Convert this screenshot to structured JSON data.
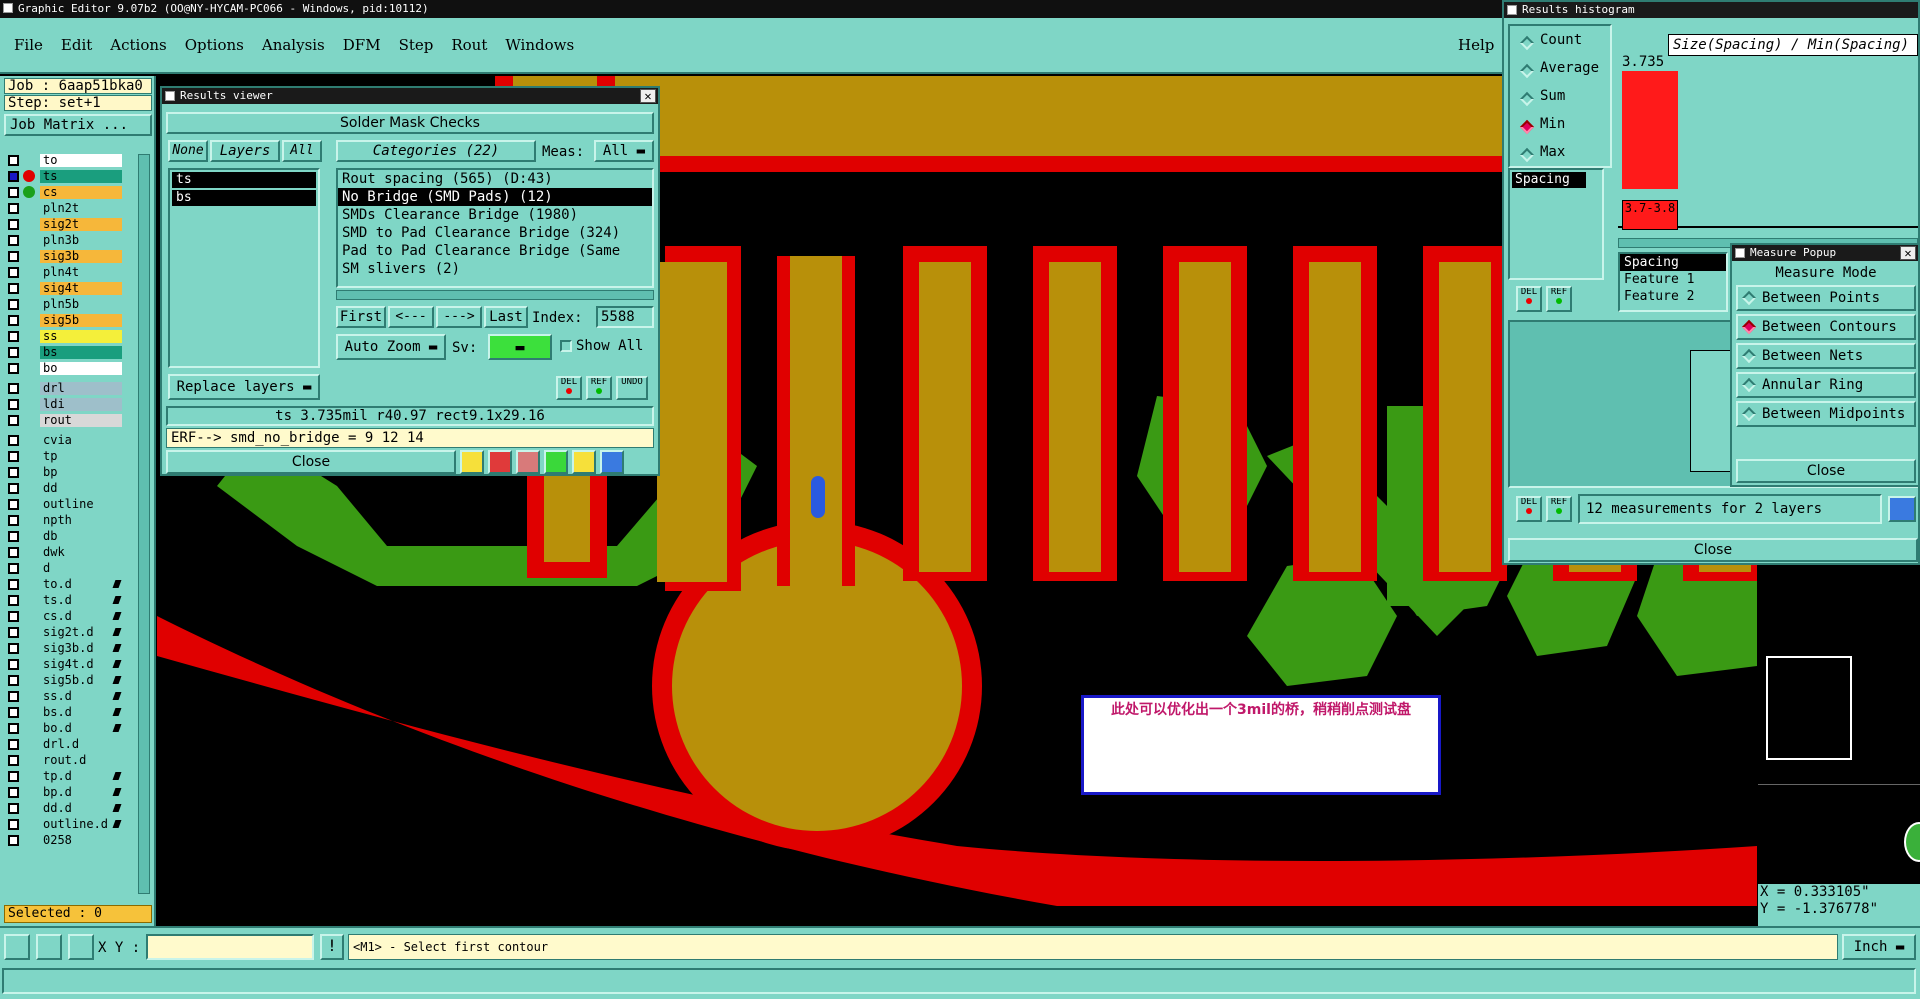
{
  "app": {
    "title": "Graphic Editor 9.07b2 (OO@NY-HYCAM-PC066 - Windows, pid:10112)",
    "menu": [
      "File",
      "Edit",
      "Actions",
      "Options",
      "Analysis",
      "DFM",
      "Step",
      "Rout",
      "Windows"
    ],
    "help": "Help"
  },
  "job": {
    "job_label": "Job : 6aap51bka0",
    "step_label": "Step: set+1",
    "matrix_button": "Job Matrix ..."
  },
  "layers": [
    {
      "name": "to",
      "bg": "#ffffff",
      "dot": ""
    },
    {
      "name": "ts",
      "bg": "#1a9e7e",
      "dot": "#e00000",
      "sel": true
    },
    {
      "name": "cs",
      "bg": "#f6b73a",
      "dot": "#1aa01a"
    },
    {
      "name": "pln2t",
      "bg": "#7fd6c6",
      "dot": ""
    },
    {
      "name": "sig2t",
      "bg": "#f6b73a",
      "dot": ""
    },
    {
      "name": "pln3b",
      "bg": "#7fd6c6",
      "dot": ""
    },
    {
      "name": "sig3b",
      "bg": "#f6b73a",
      "dot": ""
    },
    {
      "name": "pln4t",
      "bg": "#7fd6c6",
      "dot": ""
    },
    {
      "name": "sig4t",
      "bg": "#f6b73a",
      "dot": ""
    },
    {
      "name": "pln5b",
      "bg": "#7fd6c6",
      "dot": ""
    },
    {
      "name": "sig5b",
      "bg": "#f6b73a",
      "dot": ""
    },
    {
      "name": "ss",
      "bg": "#f4ef3a",
      "dot": ""
    },
    {
      "name": "bs",
      "bg": "#1a9e7e",
      "dot": ""
    },
    {
      "name": "bo",
      "bg": "#ffffff",
      "dot": ""
    },
    {
      "name": "drl",
      "bg": "#9ebfca",
      "dot": ""
    },
    {
      "name": "ldi",
      "bg": "#9ebfca",
      "dot": ""
    },
    {
      "name": "rout",
      "bg": "#d8d8d8",
      "dot": ""
    },
    {
      "name": "cvia",
      "bg": "#7fd6c6",
      "dot": ""
    },
    {
      "name": "tp",
      "bg": "#7fd6c6",
      "dot": ""
    },
    {
      "name": "bp",
      "bg": "#7fd6c6",
      "dot": ""
    },
    {
      "name": "dd",
      "bg": "#7fd6c6",
      "dot": ""
    },
    {
      "name": "outline",
      "bg": "#7fd6c6",
      "dot": ""
    },
    {
      "name": "npth",
      "bg": "#7fd6c6",
      "dot": ""
    },
    {
      "name": "db",
      "bg": "#7fd6c6",
      "dot": ""
    },
    {
      "name": "dwk",
      "bg": "#7fd6c6",
      "dot": ""
    },
    {
      "name": "d",
      "bg": "#7fd6c6",
      "dot": ""
    },
    {
      "name": "to.d",
      "bg": "#7fd6c6",
      "dot": "",
      "pen": true
    },
    {
      "name": "ts.d",
      "bg": "#7fd6c6",
      "dot": "",
      "pen": true
    },
    {
      "name": "cs.d",
      "bg": "#7fd6c6",
      "dot": "",
      "pen": true
    },
    {
      "name": "sig2t.d",
      "bg": "#7fd6c6",
      "dot": "",
      "pen": true
    },
    {
      "name": "sig3b.d",
      "bg": "#7fd6c6",
      "dot": "",
      "pen": true
    },
    {
      "name": "sig4t.d",
      "bg": "#7fd6c6",
      "dot": "",
      "pen": true
    },
    {
      "name": "sig5b.d",
      "bg": "#7fd6c6",
      "dot": "",
      "pen": true
    },
    {
      "name": "ss.d",
      "bg": "#7fd6c6",
      "dot": "",
      "pen": true
    },
    {
      "name": "bs.d",
      "bg": "#7fd6c6",
      "dot": "",
      "pen": true
    },
    {
      "name": "bo.d",
      "bg": "#7fd6c6",
      "dot": "",
      "pen": true
    },
    {
      "name": "drl.d",
      "bg": "#7fd6c6",
      "dot": ""
    },
    {
      "name": "rout.d",
      "bg": "#7fd6c6",
      "dot": ""
    },
    {
      "name": "tp.d",
      "bg": "#7fd6c6",
      "dot": "",
      "pen": true
    },
    {
      "name": "bp.d",
      "bg": "#7fd6c6",
      "dot": "",
      "pen": true
    },
    {
      "name": "dd.d",
      "bg": "#7fd6c6",
      "dot": "",
      "pen": true
    },
    {
      "name": "outline.d",
      "bg": "#7fd6c6",
      "dot": "",
      "pen": true
    },
    {
      "name": "0258",
      "bg": "#7fd6c6",
      "dot": ""
    }
  ],
  "selected_label": "Selected : 0",
  "results_viewer": {
    "title": "Results viewer",
    "header": "Solder Mask Checks",
    "none_btn": "None",
    "layers_btn": "Layers",
    "all_btn": "All",
    "categories_btn": "Categories (22)",
    "meas_label": "Meas:",
    "meas_value": "All",
    "layer_items": [
      "ts",
      "bs"
    ],
    "categories": [
      "Rout spacing (565)          (D:43)",
      "No Bridge (SMD Pads) (12)",
      "SMDs Clearance Bridge (1980)",
      "SMD to Pad Clearance Bridge (324)",
      "Pad to Pad Clearance Bridge (Same",
      "SM slivers (2)"
    ],
    "first": "First",
    "prev": "<---",
    "next": "--->",
    "last": "Last",
    "index_label": "Index:",
    "index_value": "5588",
    "auto_zoom": "Auto Zoom",
    "sv_label": "Sv:",
    "show_all": "Show All",
    "replace_layers": "Replace layers",
    "del": "DEL",
    "ref": "REF",
    "undo": "UNDO",
    "info": "ts 3.735mil  r40.97  rect9.1x29.16",
    "erf": "ERF--> smd_no_bridge = 9 12 14",
    "close": "Close"
  },
  "annotation": "此处可以优化出一个3mil的桥，稍稍削点测试盘",
  "histogram": {
    "title": "Results histogram",
    "options": [
      "Count",
      "Average",
      "Sum",
      "Min",
      "Max"
    ],
    "selected_option": "Min",
    "heading": "Size(Spacing) / Min(Spacing)",
    "list_item": "Spacing",
    "bar_label": "3.735",
    "range_label": "3.7-3.8",
    "feature_list": [
      "Spacing",
      "Feature 1",
      "Feature 2"
    ],
    "status": "12 measurements for 2 layers",
    "close": "Close",
    "chart_data": {
      "type": "bar",
      "categories": [
        "3.7-3.8"
      ],
      "values": [
        3.735
      ],
      "title": "Size(Spacing) / Min(Spacing)"
    }
  },
  "measure_popup": {
    "title": "Measure Popup",
    "mode_label": "Measure Mode",
    "modes": [
      "Between Points",
      "Between Contours",
      "Between Nets",
      "Annular Ring",
      "Between Midpoints"
    ],
    "selected_mode": "Between Contours",
    "close": "Close"
  },
  "coords": {
    "x": "X = 0.333105\"",
    "y": "Y = -1.376778\""
  },
  "bottom": {
    "xy_label": "X Y :",
    "prompt": "<M1> - Select first contour",
    "unit": "Inch"
  }
}
